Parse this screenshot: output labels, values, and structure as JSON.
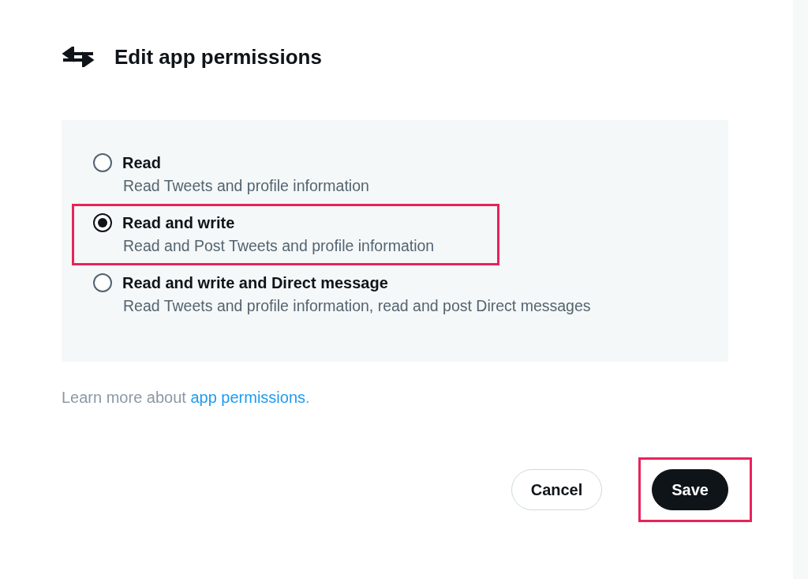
{
  "header": {
    "title": "Edit app permissions"
  },
  "options": [
    {
      "label": "Read",
      "description": "Read Tweets and profile information",
      "selected": false,
      "highlighted": false
    },
    {
      "label": "Read and write",
      "description": "Read and Post Tweets and profile information",
      "selected": true,
      "highlighted": true
    },
    {
      "label": "Read and write and Direct message",
      "description": "Read Tweets and profile information, read and post Direct messages",
      "selected": false,
      "highlighted": false
    }
  ],
  "learn_more": {
    "text": "Learn more about ",
    "link": "app permissions",
    "end": "."
  },
  "buttons": [
    {
      "label": "Cancel",
      "kind": "secondary",
      "highlighted": false
    },
    {
      "label": "Save",
      "kind": "primary",
      "highlighted": true
    }
  ]
}
